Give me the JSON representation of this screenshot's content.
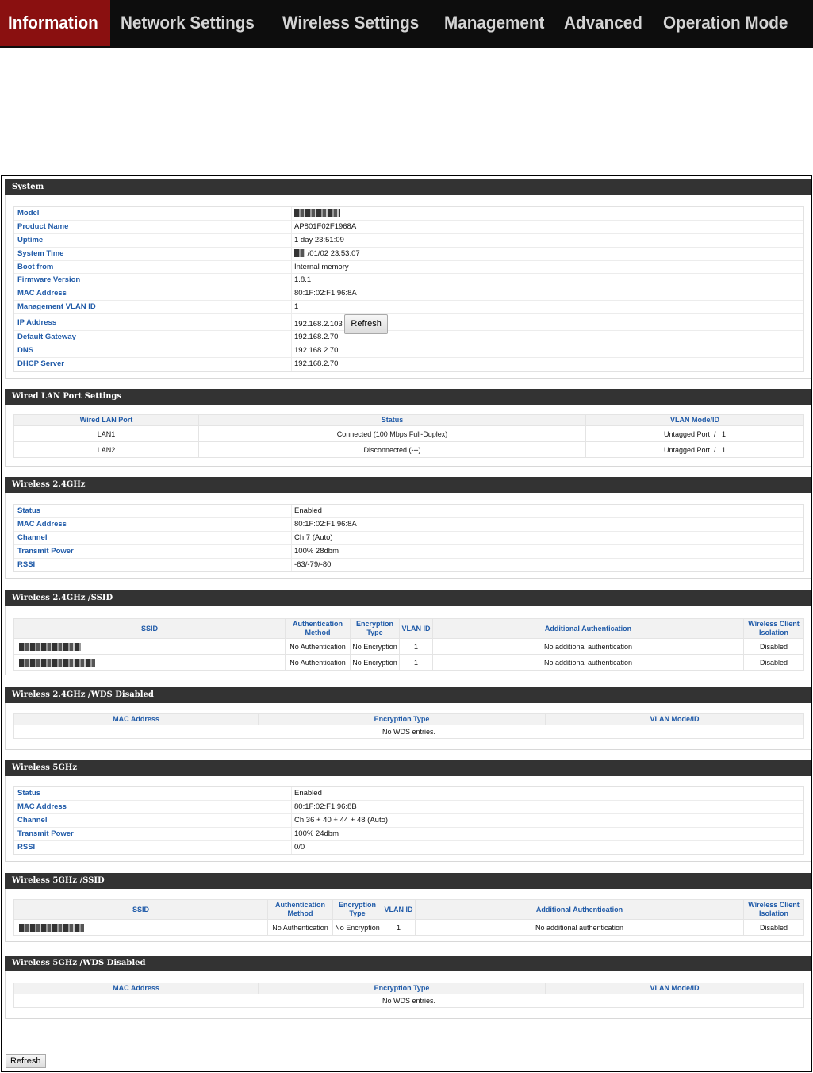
{
  "nav": {
    "tabs": [
      "Information",
      "Network Settings",
      "Wireless Settings",
      "Management",
      "Advanced",
      "Operation Mode"
    ]
  },
  "system": {
    "title": "System",
    "rows": [
      {
        "label": "Model",
        "value": ""
      },
      {
        "label": "Product Name",
        "value": "AP801F02F1968A"
      },
      {
        "label": "Uptime",
        "value": "1 day 23:51:09"
      },
      {
        "label": "System Time",
        "value": "/01/02 23:53:07"
      },
      {
        "label": "Boot from",
        "value": "Internal memory"
      },
      {
        "label": "Firmware Version",
        "value": "1.8.1"
      },
      {
        "label": "MAC Address",
        "value": "80:1F:02:F1:96:8A"
      },
      {
        "label": "Management VLAN ID",
        "value": "1"
      },
      {
        "label": "IP Address",
        "value": "192.168.2.103"
      },
      {
        "label": "Default Gateway",
        "value": "192.168.2.70"
      },
      {
        "label": "DNS",
        "value": "192.168.2.70"
      },
      {
        "label": "DHCP Server",
        "value": "192.168.2.70"
      }
    ],
    "refresh_label": "Refresh"
  },
  "wired": {
    "title": "Wired LAN Port Settings",
    "headers": [
      "Wired LAN Port",
      "Status",
      "VLAN Mode/ID"
    ],
    "rows": [
      [
        "LAN1",
        "Connected (100 Mbps Full-Duplex)",
        "Untagged Port  /   1"
      ],
      [
        "LAN2",
        "Disconnected (---)",
        "Untagged Port  /   1"
      ]
    ]
  },
  "w24": {
    "title": "Wireless 2.4GHz",
    "rows": [
      {
        "label": "Status",
        "value": "Enabled"
      },
      {
        "label": "MAC Address",
        "value": "80:1F:02:F1:96:8A"
      },
      {
        "label": "Channel",
        "value": "Ch 7 (Auto)"
      },
      {
        "label": "Transmit Power",
        "value": "100% 28dbm"
      },
      {
        "label": "RSSI",
        "value": "-63/-79/-80"
      }
    ]
  },
  "w24ssid": {
    "title": "Wireless 2.4GHz /SSID",
    "headers": [
      "SSID",
      "Authentication Method",
      "Encryption Type",
      "VLAN ID",
      "Additional Authentication",
      "Wireless Client Isolation"
    ],
    "rows": [
      [
        "",
        "No Authentication",
        "No Encryption",
        "1",
        "No additional authentication",
        "Disabled"
      ],
      [
        "",
        "No Authentication",
        "No Encryption",
        "1",
        "No additional authentication",
        "Disabled"
      ]
    ]
  },
  "w24wds": {
    "title": "Wireless 2.4GHz /WDS Disabled",
    "headers": [
      "MAC Address",
      "Encryption Type",
      "VLAN Mode/ID"
    ],
    "empty": "No WDS entries."
  },
  "w5": {
    "title": "Wireless 5GHz",
    "rows": [
      {
        "label": "Status",
        "value": "Enabled"
      },
      {
        "label": "MAC Address",
        "value": "80:1F:02:F1:96:8B"
      },
      {
        "label": "Channel",
        "value": "Ch 36 + 40 + 44 + 48 (Auto)"
      },
      {
        "label": "Transmit Power",
        "value": "100% 24dbm"
      },
      {
        "label": "RSSI",
        "value": "0/0"
      }
    ]
  },
  "w5ssid": {
    "title": "Wireless 5GHz /SSID",
    "headers": [
      "SSID",
      "Authentication Method",
      "Encryption Type",
      "VLAN ID",
      "Additional Authentication",
      "Wireless Client Isolation"
    ],
    "rows": [
      [
        "",
        "No Authentication",
        "No Encryption",
        "1",
        "No additional authentication",
        "Disabled"
      ]
    ]
  },
  "w5wds": {
    "title": "Wireless 5GHz /WDS Disabled",
    "headers": [
      "MAC Address",
      "Encryption Type",
      "VLAN Mode/ID"
    ],
    "empty": "No WDS entries."
  },
  "footer": {
    "refresh_label": "Refresh"
  }
}
